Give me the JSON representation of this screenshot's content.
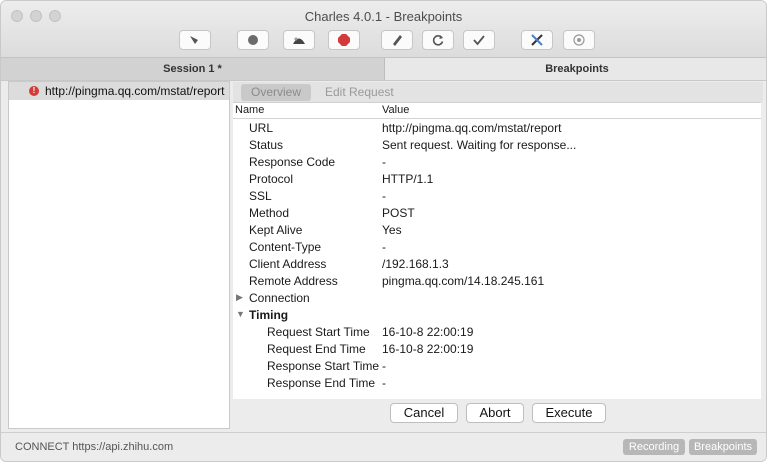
{
  "window": {
    "title": "Charles 4.0.1 - Breakpoints"
  },
  "toolbar": {
    "icons": [
      "broom-icon",
      "record-icon",
      "throttle-icon",
      "breakpoint-icon",
      "pen-icon",
      "refresh-icon",
      "check-icon",
      "tools-icon",
      "settings-icon"
    ],
    "accent_color": "#d53a3a"
  },
  "tabs": {
    "session": "Session 1 *",
    "breakpoints": "Breakpoints"
  },
  "tree": {
    "item_label": "http://pingma.qq.com/mstat/report"
  },
  "subtabs": {
    "overview": "Overview",
    "edit_request": "Edit Request"
  },
  "grid": {
    "col_name": "Name",
    "col_value": "Value",
    "rows": [
      {
        "name": "URL",
        "value": "http://pingma.qq.com/mstat/report"
      },
      {
        "name": "Status",
        "value": "Sent request. Waiting for response..."
      },
      {
        "name": "Response Code",
        "value": "-"
      },
      {
        "name": "Protocol",
        "value": "HTTP/1.1"
      },
      {
        "name": "SSL",
        "value": "-"
      },
      {
        "name": "Method",
        "value": "POST"
      },
      {
        "name": "Kept Alive",
        "value": "Yes"
      },
      {
        "name": "Content-Type",
        "value": "-"
      },
      {
        "name": "Client Address",
        "value": "/192.168.1.3"
      },
      {
        "name": "Remote Address",
        "value": "pingma.qq.com/14.18.245.161"
      }
    ],
    "connection_label": "Connection",
    "timing_label": "Timing",
    "timing_rows": [
      {
        "name": "Request Start Time",
        "value": "16-10-8 22:00:19"
      },
      {
        "name": "Request End Time",
        "value": "16-10-8 22:00:19"
      },
      {
        "name": "Response Start Time",
        "value": "-"
      },
      {
        "name": "Response End Time",
        "value": "-"
      }
    ]
  },
  "actions": {
    "cancel": "Cancel",
    "abort": "Abort",
    "execute": "Execute"
  },
  "status": {
    "text": "CONNECT https://api.zhihu.com",
    "recording": "Recording",
    "breakpoints": "Breakpoints"
  }
}
